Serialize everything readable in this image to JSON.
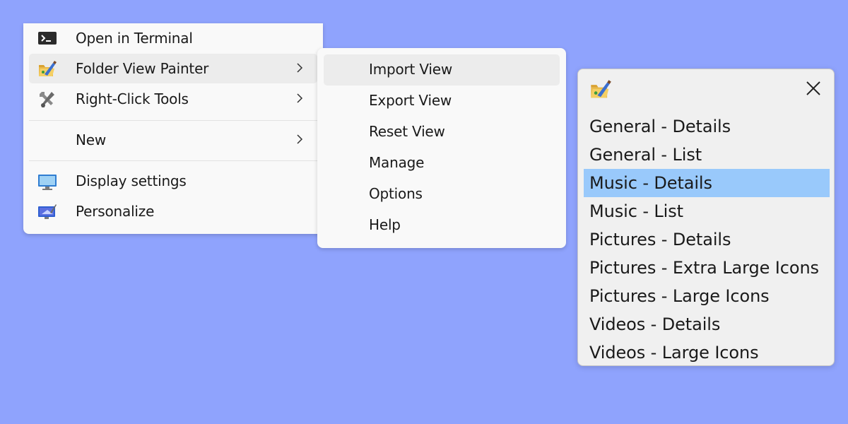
{
  "context_menu": {
    "items": [
      {
        "label": "Open in Terminal",
        "icon": "terminal-icon"
      },
      {
        "label": "Folder View Painter",
        "icon": "folder-view-painter-icon",
        "has_submenu": true,
        "highlighted": true
      },
      {
        "label": "Right-Click Tools",
        "icon": "tools-icon",
        "has_submenu": true
      },
      {
        "label": "New",
        "icon": "",
        "has_submenu": true
      },
      {
        "label": "Display settings",
        "icon": "monitor-icon"
      },
      {
        "label": "Personalize",
        "icon": "personalize-icon"
      }
    ]
  },
  "submenu": {
    "items": [
      {
        "label": "Import View",
        "highlighted": true
      },
      {
        "label": "Export View"
      },
      {
        "label": "Reset View"
      },
      {
        "label": "Manage"
      },
      {
        "label": "Options"
      },
      {
        "label": "Help"
      }
    ]
  },
  "view_popup": {
    "icon": "folder-view-painter-icon",
    "close_icon": "close-icon",
    "items": [
      {
        "label": "General - Details"
      },
      {
        "label": "General - List"
      },
      {
        "label": "Music - Details",
        "selected": true
      },
      {
        "label": "Music - List"
      },
      {
        "label": "Pictures - Details"
      },
      {
        "label": "Pictures - Extra Large Icons"
      },
      {
        "label": "Pictures - Large Icons"
      },
      {
        "label": "Videos - Details"
      },
      {
        "label": "Videos - Large Icons"
      }
    ],
    "selection_color": "#99c9fb"
  },
  "colors": {
    "desktop_background": "#8fa3fd",
    "menu_background": "#f9f9f9",
    "hover_background": "#ececec"
  }
}
